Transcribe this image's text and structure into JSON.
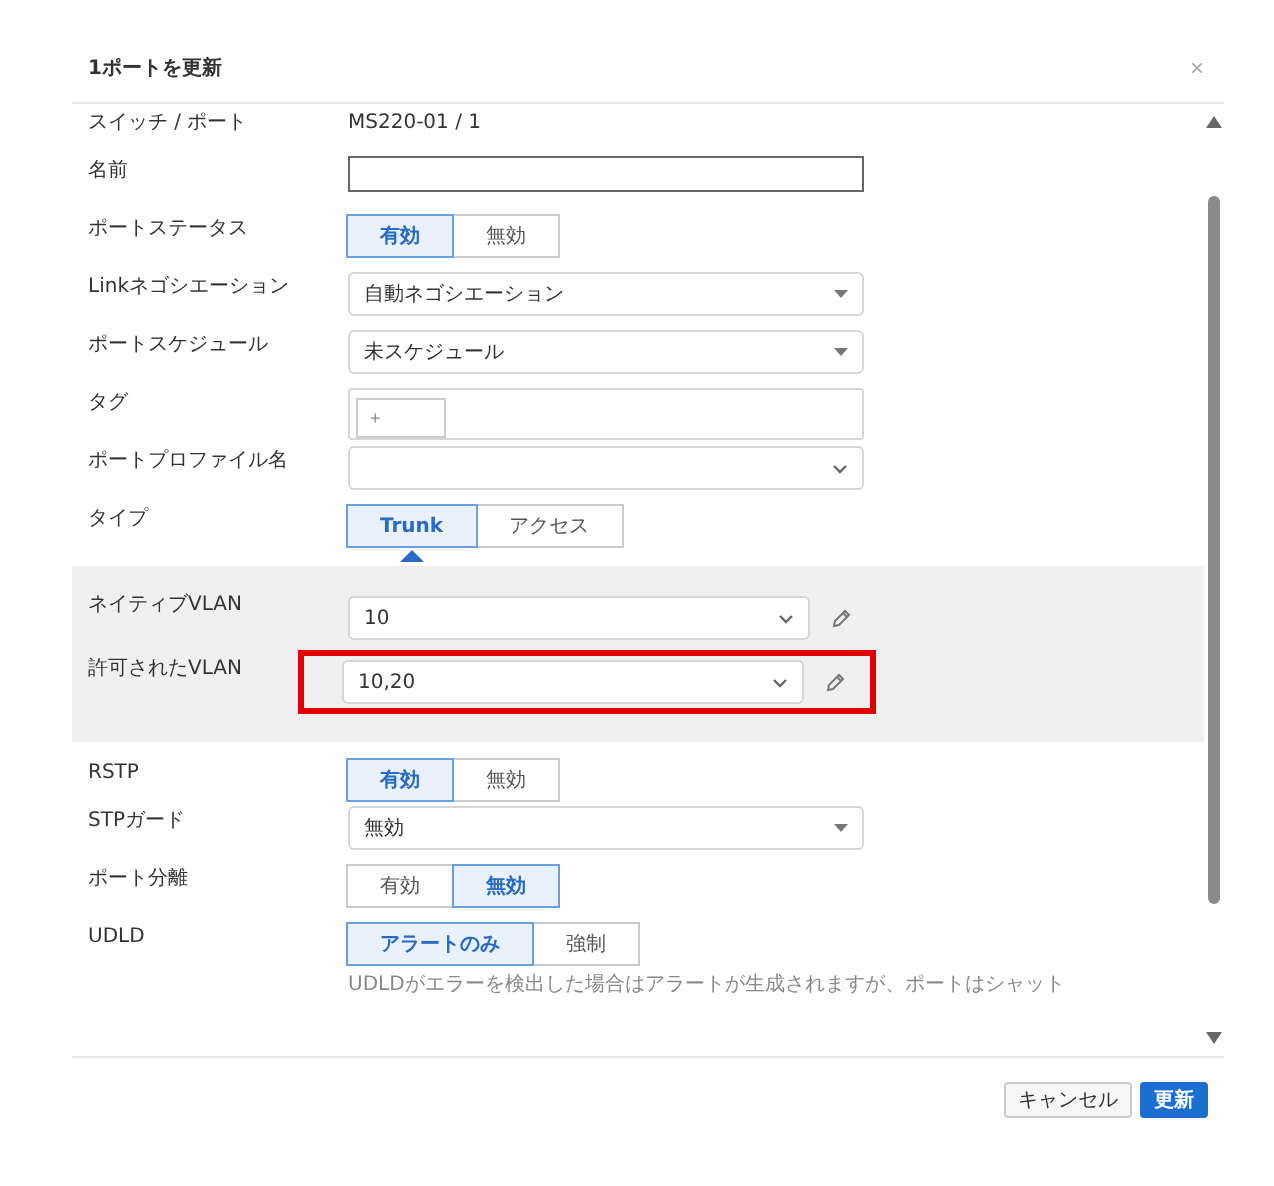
{
  "dialog": {
    "title": "1ポートを更新",
    "close": "×"
  },
  "fields": [
    {
      "kind": "text",
      "label": "スイッチ / ポート",
      "value": "MS220-01 / 1"
    },
    {
      "kind": "input",
      "label": "名前"
    },
    {
      "kind": "toggle",
      "label": "ポートステータス",
      "options": [
        {
          "label": "有効",
          "selected": true
        },
        {
          "label": "無効",
          "selected": false
        }
      ]
    },
    {
      "kind": "select",
      "label": "Linkネゴシエーション",
      "value": "自動ネゴシエーション"
    },
    {
      "kind": "select",
      "label": "ポートスケジュール",
      "value": "未スケジュール"
    },
    {
      "kind": "tags",
      "label": "タグ",
      "add": "+"
    },
    {
      "kind": "combo",
      "label": "ポートプロファイル名"
    },
    {
      "kind": "tabs",
      "label": "タイプ",
      "options": [
        {
          "label": "Trunk",
          "selected": true
        },
        {
          "label": "アクセス",
          "selected": false
        }
      ]
    }
  ],
  "vlan_rows": [
    {
      "label": "ネイティブVLAN",
      "value": "10",
      "highlighted": false
    },
    {
      "label": "許可されたVLAN",
      "value": "10,20",
      "highlighted": true
    }
  ],
  "lower_fields": [
    {
      "kind": "toggle",
      "label": "RSTP",
      "options": [
        {
          "label": "有効",
          "selected": true
        },
        {
          "label": "無効",
          "selected": false
        }
      ]
    },
    {
      "kind": "select",
      "label": "STPガード",
      "value": "無効"
    },
    {
      "kind": "toggle",
      "label": "ポート分離",
      "options": [
        {
          "label": "有効",
          "selected": false
        },
        {
          "label": "無効",
          "selected": true
        }
      ]
    },
    {
      "kind": "toggle",
      "label": "UDLD",
      "options": [
        {
          "label": "アラートのみ",
          "selected": true
        },
        {
          "label": "強制",
          "selected": false
        }
      ],
      "note": "UDLDがエラーを検出した場合はアラートが生成されますが、ポートはシャット"
    }
  ],
  "buttons": [
    {
      "label": "キャンセル",
      "kind": "secondary"
    },
    {
      "label": "更新",
      "kind": "primary"
    }
  ]
}
